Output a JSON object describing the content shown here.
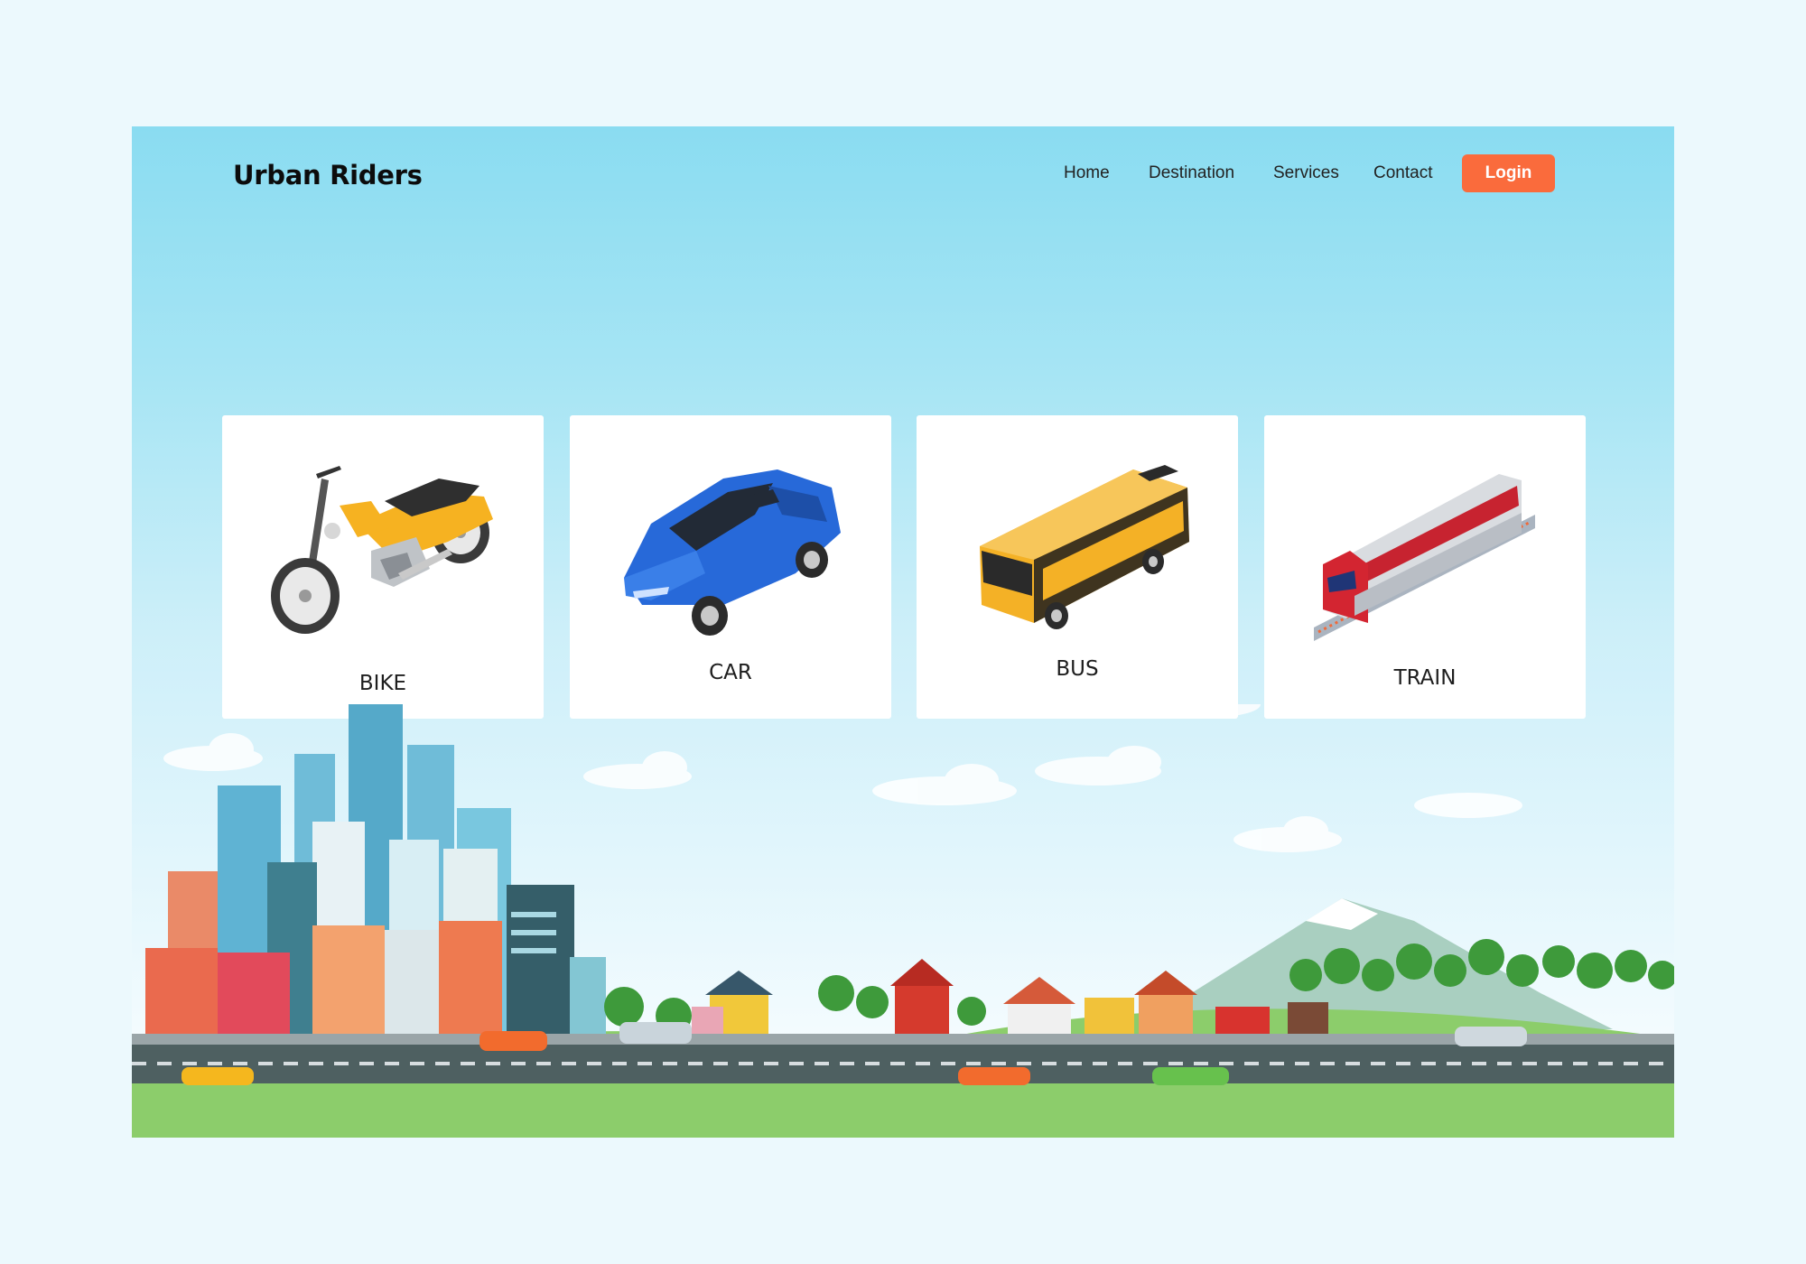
{
  "brand": {
    "name": "Urban Riders"
  },
  "nav": {
    "links": [
      "Home",
      "Destination",
      "Services",
      "Contact"
    ],
    "login_label": "Login"
  },
  "transport_cards": [
    {
      "label": "BIKE",
      "icon": "motorcycle-icon"
    },
    {
      "label": "CAR",
      "icon": "car-icon"
    },
    {
      "label": "BUS",
      "icon": "bus-icon"
    },
    {
      "label": "TRAIN",
      "icon": "train-icon"
    }
  ],
  "colors": {
    "accent": "#fa6b3c",
    "sky_top": "#8adcf1",
    "page_background": "#ecf9fd"
  }
}
